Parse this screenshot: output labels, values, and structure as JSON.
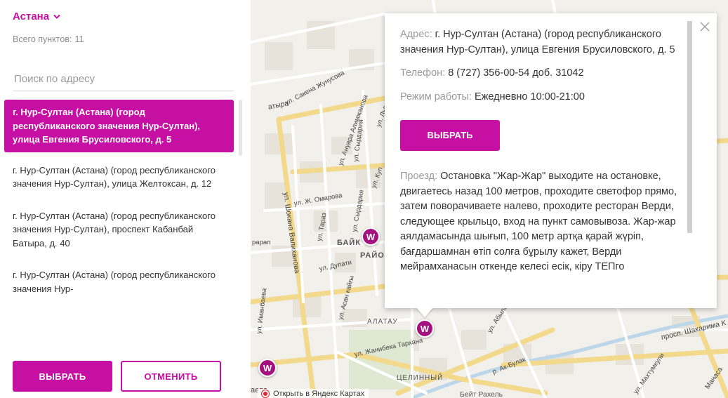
{
  "sidebar": {
    "city": "Астана",
    "total_label": "Всего пунктов:",
    "total_count": "11",
    "search_placeholder": "Поиск по адресу",
    "items": [
      {
        "label": "г. Нур-Султан (Астана) (город республиканского значения Нур-Султан), улица Евгения Брусиловского, д. 5"
      },
      {
        "label": "г. Нур-Султан (Астана) (город республиканского значения Нур-Султан), улица Желтоксан, д. 12"
      },
      {
        "label": "г. Нур-Султан (Астана) (город республиканского значения Нур-Султан), проспект Кабанбай Батыра, д. 40"
      },
      {
        "label": "г. Нур-Султан (Астана) (город республиканского значения Нур-"
      }
    ],
    "select_label": "ВЫБРАТЬ",
    "cancel_label": "ОТМЕНИТЬ"
  },
  "balloon": {
    "address_label": "Адрес:",
    "address_value": "г. Нур-Султан (Астана) (город республиканского значения Нур-Султан), улица Евгения Брусиловского, д. 5",
    "phone_label": "Телефон:",
    "phone_value": "8 (727) 356-00-54 доб. 31042",
    "hours_label": "Режим работы:",
    "hours_value": "Ежедневно 10:00-21:00",
    "select_label": "ВЫБРАТЬ",
    "route_label": "Проезд:",
    "route_value": "Остановка \"Жар-Жар\" выходите на остановке, двигаетесь назад 100 метров, проходите светофор прямо, затем поворачиваете налево, проходите ресторан Верди, следующее крыльцо, вход на пункт самовывоза. Жар-жар аялдамасында шығып, 100 метр артқа қарай жүріп, бағдаршамнан өтіп солға бұрылу кажет, Верди мейрамханасын откенде келесі есік, кіру ТЕПго"
  },
  "map": {
    "streets": {
      "s1": "атыра",
      "s2": "ул. Сакена Жунусова",
      "s3": "ул. Ануара Алимжанова",
      "s4": "ул. Сырдария",
      "s5": "ул. Львов",
      "s6": "ул. Шокана Валиханова",
      "s7": "ул. Ж. Омарова",
      "s8": "ул. Сырдария",
      "s9": "ул. Тараз",
      "s10": "ул. Дулати",
      "s11": "ул. Асан кайғы",
      "s12": "ул. Иманбаева",
      "s13": "ул. Жанибека Тархана",
      "s14": "ул. Абылай Янушка",
      "s15": "просп. Шакарима К",
      "s16": "ул. Махтумкули",
      "s17": "р. Ак-Булак",
      "s18": "ул. Куп",
      "s19": "рарап",
      "s20": "Манаса",
      "s21": "аева"
    },
    "areas": {
      "a1": "БАЙК",
      "a2": "РАЙО",
      "a3": "АЛАТАУ",
      "a4": "ЦЕЛИННЫЙ",
      "a5": "Бейт Рахель"
    },
    "pin_letter": "W",
    "yandex_link": "Открыть в Яндекс Картах"
  },
  "colors": {
    "accent": "#c60fa3",
    "pin": "#a4107e"
  }
}
